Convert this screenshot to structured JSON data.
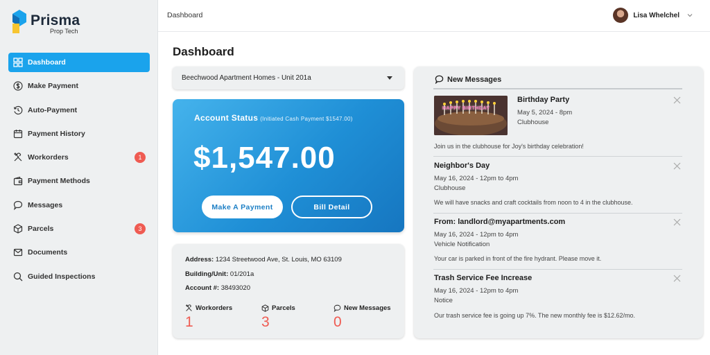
{
  "app": {
    "name": "Prisma",
    "subtitle": "Prop Tech"
  },
  "sidebar": {
    "items": [
      {
        "label": "Dashboard",
        "icon": "grid-icon",
        "active": true
      },
      {
        "label": "Make Payment",
        "icon": "dollar-circle-icon"
      },
      {
        "label": "Auto-Payment",
        "icon": "history-icon"
      },
      {
        "label": "Payment History",
        "icon": "calendar-icon"
      },
      {
        "label": "Workorders",
        "icon": "tools-icon",
        "badge": "1"
      },
      {
        "label": "Payment Methods",
        "icon": "wallet-icon"
      },
      {
        "label": "Messages",
        "icon": "chat-bubble-icon"
      },
      {
        "label": "Parcels",
        "icon": "box-icon",
        "badge": "3"
      },
      {
        "label": "Documents",
        "icon": "mail-icon"
      },
      {
        "label": "Guided Inspections",
        "icon": "search-icon"
      }
    ]
  },
  "header": {
    "breadcrumb": "Dashboard",
    "user_name": "Lisa Whelchel"
  },
  "main": {
    "title": "Dashboard",
    "property_select": "Beechwood Apartment Homes - Unit 201a",
    "account_status": {
      "title": "Account Status",
      "subtitle": "(Initiated Cash Payment $1547.00)",
      "amount": "$1,547.00",
      "make_payment_label": "Make A Payment",
      "bill_detail_label": "Bill Detail"
    },
    "info": {
      "address_label": "Address:",
      "address_value": "1234 Streetwood Ave, St. Louis, MO 63109",
      "unit_label": "Building/Unit:",
      "unit_value": "01/201a",
      "account_label": "Account #:",
      "account_value": "38493020",
      "stats": [
        {
          "label": "Workorders",
          "value": "1",
          "icon": "tools-icon"
        },
        {
          "label": "Parcels",
          "value": "3",
          "icon": "box-icon"
        },
        {
          "label": "New Messages",
          "value": "0",
          "icon": "chat-bubble-icon"
        }
      ]
    }
  },
  "messages": {
    "header": "New Messages",
    "items": [
      {
        "title": "Birthday Party",
        "date": "May 5, 2024 - 8pm",
        "location": "Clubhouse",
        "body": "Join us in the clubhouse for Joy's birthday celebration!",
        "image_banner": "HAPPY BIRTHDAY"
      },
      {
        "title": "Neighbor's Day",
        "date": "May 16, 2024 - 12pm to 4pm",
        "location": "Clubhouse",
        "body": "We will have snacks and craft cocktails from noon to 4 in the clubhouse."
      },
      {
        "title": "From: landlord@myapartments.com",
        "date": "May 16, 2024 - 12pm to 4pm",
        "location": "Vehicle Notification",
        "body": "Your car is parked in front of the fire hydrant. Please move it."
      },
      {
        "title": "Trash Service Fee Increase",
        "date": "May 16, 2024 - 12pm to 4pm",
        "location": "Notice",
        "body": "Our trash service fee is going up 7%. The new monthly fee is $12.62/mo."
      }
    ]
  },
  "colors": {
    "accent": "#1aa3ec",
    "badge": "#ef5b52",
    "card_gradient_start": "#45b3ec",
    "card_gradient_end": "#1676c0"
  }
}
